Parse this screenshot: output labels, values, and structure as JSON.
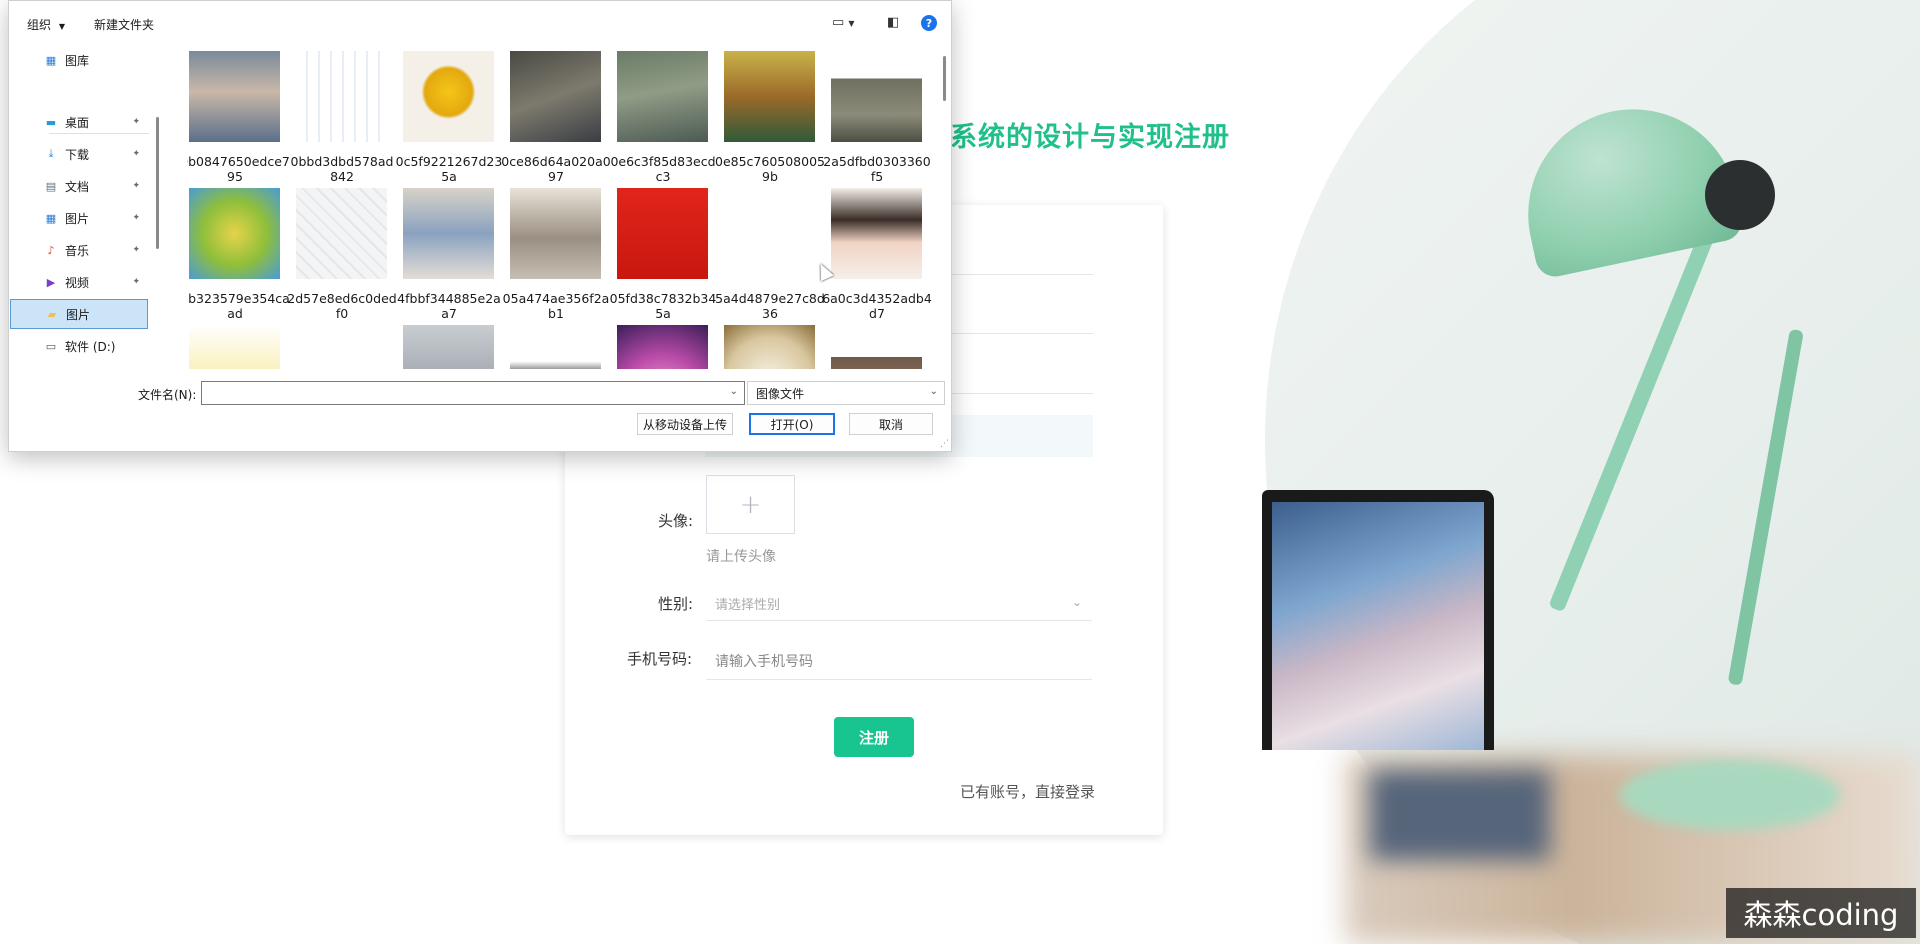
{
  "page": {
    "title_visible": "系统的设计与实现注册",
    "form": {
      "avatar_label": "头像:",
      "avatar_plus": "+",
      "avatar_hint": "请上传头像",
      "gender_label": "性别:",
      "gender_placeholder": "请选择性别",
      "phone_label": "手机号码:",
      "phone_placeholder": "请输入手机号码",
      "register_button": "注册",
      "login_link": "已有账号，直接登录"
    },
    "watermark": "森森coding",
    "accent_color": "#18c48f"
  },
  "dialog": {
    "toolbar": {
      "organize": "组织",
      "new_folder": "新建文件夹",
      "help_icon": "?"
    },
    "nav": [
      {
        "label": "图库",
        "icon": "gallery-icon",
        "pinned": false
      },
      {
        "label": "桌面",
        "icon": "desktop-icon",
        "pinned": true
      },
      {
        "label": "下载",
        "icon": "download-icon",
        "pinned": true
      },
      {
        "label": "文档",
        "icon": "document-icon",
        "pinned": true
      },
      {
        "label": "图片",
        "icon": "pictures-icon",
        "pinned": true
      },
      {
        "label": "音乐",
        "icon": "music-icon",
        "pinned": true
      },
      {
        "label": "视频",
        "icon": "video-icon",
        "pinned": true
      },
      {
        "label": "图片",
        "icon": "folder-icon",
        "pinned": false,
        "selected": true
      },
      {
        "label": "软件 (D:)",
        "icon": "drive-icon",
        "pinned": false
      }
    ],
    "files": [
      {
        "name": "0b0847650edce795"
      },
      {
        "name": "0bbd3dbd578ad842"
      },
      {
        "name": "0c5f9221267d235a"
      },
      {
        "name": "0ce86d64a020a097"
      },
      {
        "name": "0e6c3f85d83ecdc3"
      },
      {
        "name": "0e85c7605080059b"
      },
      {
        "name": "2a5dfbd0303360f5"
      },
      {
        "name": "2b323579e354caad"
      },
      {
        "name": "2d57e8ed6c0dedf0"
      },
      {
        "name": "4fbbf344885e2aa7"
      },
      {
        "name": "05a474ae356f2ab1"
      },
      {
        "name": "05fd38c7832b345a"
      },
      {
        "name": "5a4d4879e27c8d36"
      },
      {
        "name": "6a0c3d4352adb4d7"
      },
      {
        "name": ""
      },
      {
        "name": ""
      },
      {
        "name": ""
      },
      {
        "name": ""
      },
      {
        "name": ""
      },
      {
        "name": ""
      },
      {
        "name": ""
      }
    ],
    "filename_label": "文件名(N):",
    "filename_value": "",
    "filetype": "图像文件",
    "upload_mobile": "从移动设备上传",
    "open_button": "打开(O)",
    "cancel_button": "取消"
  }
}
